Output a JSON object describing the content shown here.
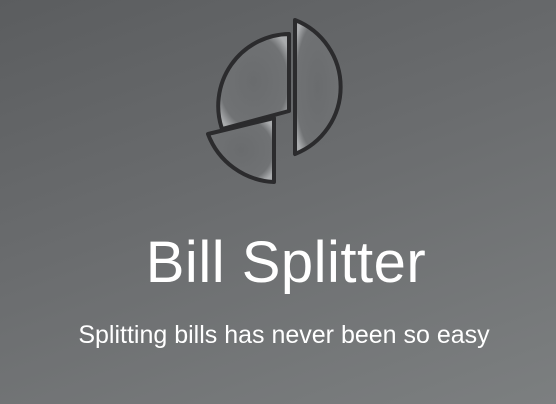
{
  "app": {
    "title": "Bill Splitter",
    "tagline": "Splitting bills has never been so easy"
  },
  "logo": {
    "icon": "pie-chart-icon"
  },
  "colors": {
    "background": "#6a6c6e",
    "text": "#ffffff",
    "logo_fill": "#6e7072",
    "logo_stroke": "#2b2b2d"
  }
}
